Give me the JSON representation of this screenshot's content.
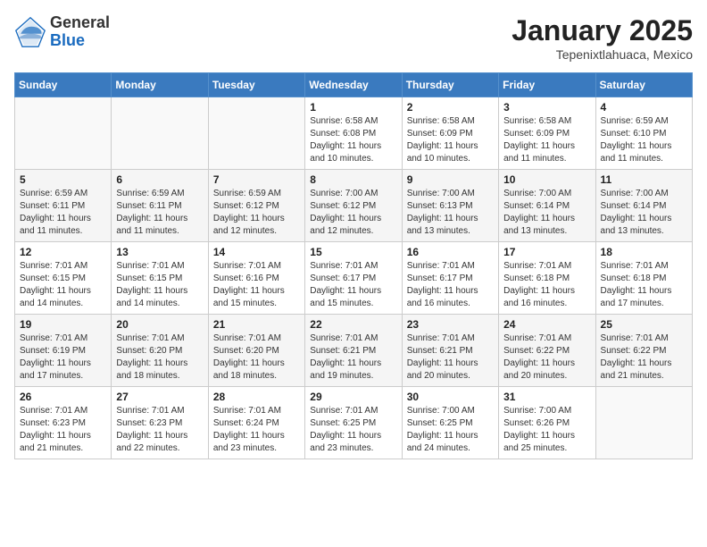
{
  "header": {
    "logo_general": "General",
    "logo_blue": "Blue",
    "month": "January 2025",
    "location": "Tepenixtlahuaca, Mexico"
  },
  "weekdays": [
    "Sunday",
    "Monday",
    "Tuesday",
    "Wednesday",
    "Thursday",
    "Friday",
    "Saturday"
  ],
  "weeks": [
    [
      {
        "day": "",
        "text": ""
      },
      {
        "day": "",
        "text": ""
      },
      {
        "day": "",
        "text": ""
      },
      {
        "day": "1",
        "text": "Sunrise: 6:58 AM\nSunset: 6:08 PM\nDaylight: 11 hours\nand 10 minutes."
      },
      {
        "day": "2",
        "text": "Sunrise: 6:58 AM\nSunset: 6:09 PM\nDaylight: 11 hours\nand 10 minutes."
      },
      {
        "day": "3",
        "text": "Sunrise: 6:58 AM\nSunset: 6:09 PM\nDaylight: 11 hours\nand 11 minutes."
      },
      {
        "day": "4",
        "text": "Sunrise: 6:59 AM\nSunset: 6:10 PM\nDaylight: 11 hours\nand 11 minutes."
      }
    ],
    [
      {
        "day": "5",
        "text": "Sunrise: 6:59 AM\nSunset: 6:11 PM\nDaylight: 11 hours\nand 11 minutes."
      },
      {
        "day": "6",
        "text": "Sunrise: 6:59 AM\nSunset: 6:11 PM\nDaylight: 11 hours\nand 11 minutes."
      },
      {
        "day": "7",
        "text": "Sunrise: 6:59 AM\nSunset: 6:12 PM\nDaylight: 11 hours\nand 12 minutes."
      },
      {
        "day": "8",
        "text": "Sunrise: 7:00 AM\nSunset: 6:12 PM\nDaylight: 11 hours\nand 12 minutes."
      },
      {
        "day": "9",
        "text": "Sunrise: 7:00 AM\nSunset: 6:13 PM\nDaylight: 11 hours\nand 13 minutes."
      },
      {
        "day": "10",
        "text": "Sunrise: 7:00 AM\nSunset: 6:14 PM\nDaylight: 11 hours\nand 13 minutes."
      },
      {
        "day": "11",
        "text": "Sunrise: 7:00 AM\nSunset: 6:14 PM\nDaylight: 11 hours\nand 13 minutes."
      }
    ],
    [
      {
        "day": "12",
        "text": "Sunrise: 7:01 AM\nSunset: 6:15 PM\nDaylight: 11 hours\nand 14 minutes."
      },
      {
        "day": "13",
        "text": "Sunrise: 7:01 AM\nSunset: 6:15 PM\nDaylight: 11 hours\nand 14 minutes."
      },
      {
        "day": "14",
        "text": "Sunrise: 7:01 AM\nSunset: 6:16 PM\nDaylight: 11 hours\nand 15 minutes."
      },
      {
        "day": "15",
        "text": "Sunrise: 7:01 AM\nSunset: 6:17 PM\nDaylight: 11 hours\nand 15 minutes."
      },
      {
        "day": "16",
        "text": "Sunrise: 7:01 AM\nSunset: 6:17 PM\nDaylight: 11 hours\nand 16 minutes."
      },
      {
        "day": "17",
        "text": "Sunrise: 7:01 AM\nSunset: 6:18 PM\nDaylight: 11 hours\nand 16 minutes."
      },
      {
        "day": "18",
        "text": "Sunrise: 7:01 AM\nSunset: 6:18 PM\nDaylight: 11 hours\nand 17 minutes."
      }
    ],
    [
      {
        "day": "19",
        "text": "Sunrise: 7:01 AM\nSunset: 6:19 PM\nDaylight: 11 hours\nand 17 minutes."
      },
      {
        "day": "20",
        "text": "Sunrise: 7:01 AM\nSunset: 6:20 PM\nDaylight: 11 hours\nand 18 minutes."
      },
      {
        "day": "21",
        "text": "Sunrise: 7:01 AM\nSunset: 6:20 PM\nDaylight: 11 hours\nand 18 minutes."
      },
      {
        "day": "22",
        "text": "Sunrise: 7:01 AM\nSunset: 6:21 PM\nDaylight: 11 hours\nand 19 minutes."
      },
      {
        "day": "23",
        "text": "Sunrise: 7:01 AM\nSunset: 6:21 PM\nDaylight: 11 hours\nand 20 minutes."
      },
      {
        "day": "24",
        "text": "Sunrise: 7:01 AM\nSunset: 6:22 PM\nDaylight: 11 hours\nand 20 minutes."
      },
      {
        "day": "25",
        "text": "Sunrise: 7:01 AM\nSunset: 6:22 PM\nDaylight: 11 hours\nand 21 minutes."
      }
    ],
    [
      {
        "day": "26",
        "text": "Sunrise: 7:01 AM\nSunset: 6:23 PM\nDaylight: 11 hours\nand 21 minutes."
      },
      {
        "day": "27",
        "text": "Sunrise: 7:01 AM\nSunset: 6:23 PM\nDaylight: 11 hours\nand 22 minutes."
      },
      {
        "day": "28",
        "text": "Sunrise: 7:01 AM\nSunset: 6:24 PM\nDaylight: 11 hours\nand 23 minutes."
      },
      {
        "day": "29",
        "text": "Sunrise: 7:01 AM\nSunset: 6:25 PM\nDaylight: 11 hours\nand 23 minutes."
      },
      {
        "day": "30",
        "text": "Sunrise: 7:00 AM\nSunset: 6:25 PM\nDaylight: 11 hours\nand 24 minutes."
      },
      {
        "day": "31",
        "text": "Sunrise: 7:00 AM\nSunset: 6:26 PM\nDaylight: 11 hours\nand 25 minutes."
      },
      {
        "day": "",
        "text": ""
      }
    ]
  ]
}
